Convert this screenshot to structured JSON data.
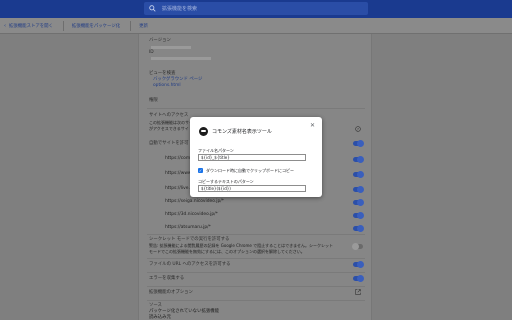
{
  "header": {
    "search_placeholder": "拡張機能を検索"
  },
  "toolbar": {
    "items": [
      {
        "label": "拡張機能ストアを開く"
      },
      {
        "label": "拡張機能をパッケージ化"
      },
      {
        "label": "更新"
      }
    ]
  },
  "details": {
    "section_version": "バージョン",
    "id_label": "ID",
    "view_label": "ビューを検査",
    "view_link_1": "バックグラウンド ページ",
    "view_link_2": "options.html",
    "perm_label": "権限",
    "site_access_label": "サイトへのアクセス",
    "site_access_desc": "この拡張機能は次のサイト上の情報を読み取り、変更できます。拡張機能",
    "site_access_desc2": "がアクセスできるサイトを管理します。",
    "auto_label": "自動でサイトを許可",
    "sites": [
      "https://commons.nicovideo.jp/*",
      "https://www.nicovideo.jp/*",
      "https://live.nicovideo.jp/*",
      "https://seiga.nicovideo.jp/*",
      "https://3d.nicovideo.jp/*",
      "https://atsumaru.jp/*"
    ],
    "incognito_title": "シークレット モードでの実行を許可する",
    "incognito_desc1": "警告: 拡張機能による閲覧履歴の記録を Google Chrome で阻止することはできません。シークレット",
    "incognito_desc2": "モードでこの拡張機能を無効にするには、このオプションの選択を解除してください。",
    "file_url_label": "ファイルの URL へのアクセスを許可する",
    "error_label": "エラーを収集する",
    "options_label": "拡張機能のオプション",
    "source_label": "ソース",
    "source_desc": "パッケージ化されていない拡張機能",
    "load_label": "読み込み元"
  },
  "dialog": {
    "title": "コモンズ素材名表示ツール",
    "close_icon": "close-icon",
    "file_label": "ファイル名パターン",
    "file_value": "${id}_${title}",
    "checkbox_label": "ダウンロード時に自動でクリップボードにコピー",
    "text_label": "コピーするテキストのパターン",
    "text_value": "${title}(${id})"
  },
  "colors": {
    "topbar": "#1a3a8f",
    "accent": "#1a73e8",
    "toggle_on": "#2b4fa8"
  }
}
